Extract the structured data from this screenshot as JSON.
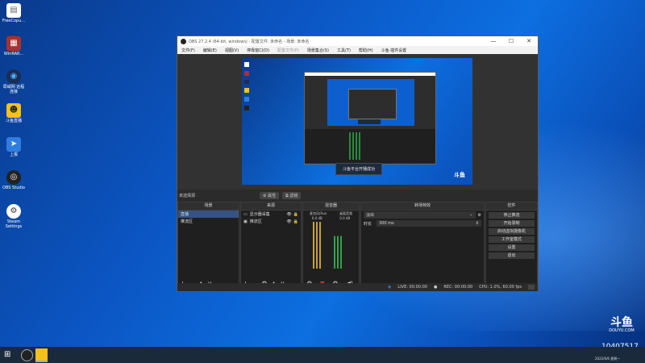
{
  "desktop": {
    "icons": [
      {
        "name": "doc-icon",
        "label": "FreeCopu...",
        "color": "#ffffff"
      },
      {
        "name": "winrar-icon",
        "label": "WinRAR...",
        "color": "#a8322e"
      },
      {
        "name": "teamviewer-icon",
        "label": "局域网 远程连接",
        "color": "#1a2d55"
      },
      {
        "name": "game-icon",
        "label": "斗鱼直播",
        "color": "#f5c21b"
      },
      {
        "name": "send-icon",
        "label": "上报",
        "color": "#2f7de0"
      },
      {
        "name": "obs-icon",
        "label": "OBS Studio",
        "color": "#222222"
      },
      {
        "name": "steam-icon",
        "label": "Steam Settings",
        "color": "#ffffff"
      }
    ]
  },
  "obs": {
    "title": "OBS 27.2.4 (64-bit, windows) - 配置文件: 未命名 - 场景: 未命名",
    "controls": {
      "minimize": "—",
      "maximize": "☐",
      "close": "✕"
    },
    "menu": [
      "文件(F)",
      "编辑(E)",
      "视图(V)",
      "停靠窗口(D)",
      "配置文件(P)",
      "场景集合(S)",
      "工具(T)",
      "帮助(H)",
      "斗鱼·插件设置"
    ],
    "preview": {
      "toast": "斗鱼平台开播成功"
    },
    "scene_bar": {
      "label": "未选择源",
      "props": "⚙ 属性",
      "filters": "⧉ 滤镜"
    },
    "docks": {
      "scenes": {
        "title": "场景",
        "items": [
          "直播",
          "推流区"
        ]
      },
      "sources": {
        "title": "来源",
        "items": [
          "显示器采集",
          "推流区"
        ]
      },
      "mixer": {
        "title": "混音器",
        "ch1": "麦克风/Aux",
        "ch2": "桌面音频",
        "db1": "0.0 dB",
        "db2": "0.0 dB"
      },
      "transitions": {
        "title": "转场特效",
        "type": "淡出",
        "duration_label": "时长",
        "duration": "300 ms"
      },
      "controls": {
        "title": "控件",
        "buttons": [
          "停止推流",
          "开始录制",
          "启动虚拟摄像机",
          "工作室模式",
          "设置",
          "退出"
        ]
      }
    },
    "status": {
      "live": "LIVE: 00:00:00",
      "rec": "REC: 00:00:00",
      "cpu": "CPU: 1.0%, 60.00 fps"
    }
  },
  "watermark": {
    "logo": "斗鱼",
    "url": "DOUYU.COM",
    "room": "10407517",
    "date": "2022/6/6 星期一"
  }
}
